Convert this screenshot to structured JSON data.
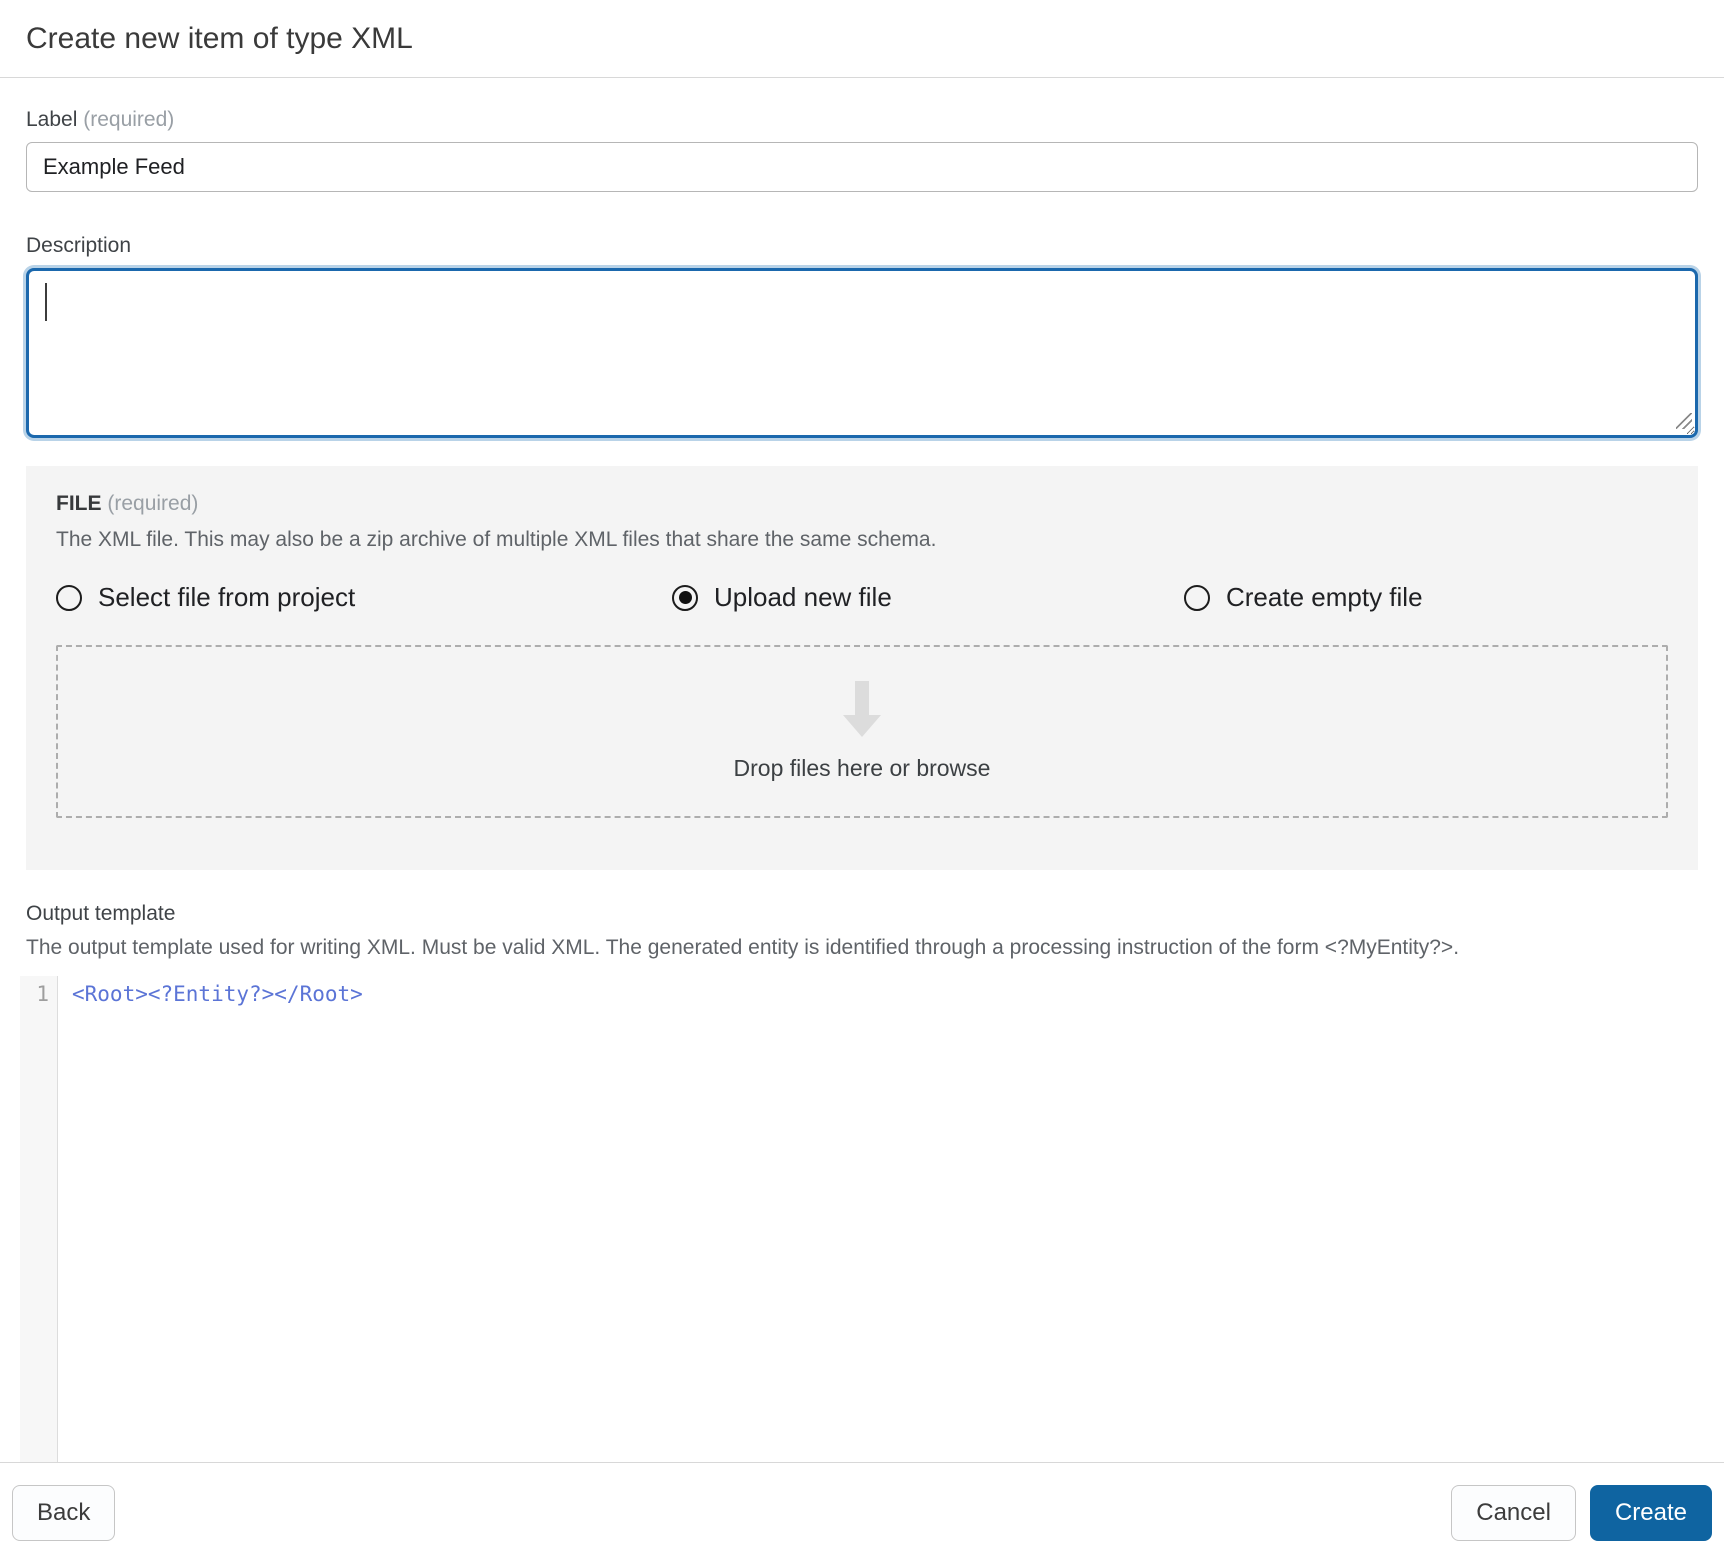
{
  "dialog": {
    "title": "Create new item of type XML"
  },
  "label_field": {
    "label": "Label",
    "required": "(required)",
    "value": "Example Feed"
  },
  "description_field": {
    "label": "Description",
    "value": ""
  },
  "file_section": {
    "label": "FILE",
    "required": "(required)",
    "help": "The XML file. This may also be a zip archive of multiple XML files that share the same schema.",
    "options": [
      {
        "label": "Select file from project",
        "selected": false
      },
      {
        "label": "Upload new file",
        "selected": true
      },
      {
        "label": "Create empty file",
        "selected": false
      }
    ],
    "dropzone": {
      "text": "Drop files here or browse",
      "icon": "arrow-down-icon"
    }
  },
  "output_template": {
    "label": "Output template",
    "help": "The output template used for writing XML. Must be valid XML. The generated entity is identified through a processing instruction of the form <?MyEntity?>.",
    "editor": {
      "line_number": "1",
      "code": "<Root><?Entity?></Root>"
    }
  },
  "footer": {
    "back_label": "Back",
    "cancel_label": "Cancel",
    "create_label": "Create"
  },
  "colors": {
    "focus_border": "#1b68ad",
    "focus_glow": "#b9d3e8",
    "panel_bg": "#f4f4f4",
    "create_button": "#0f64a1",
    "code_text": "#5b74d6"
  }
}
